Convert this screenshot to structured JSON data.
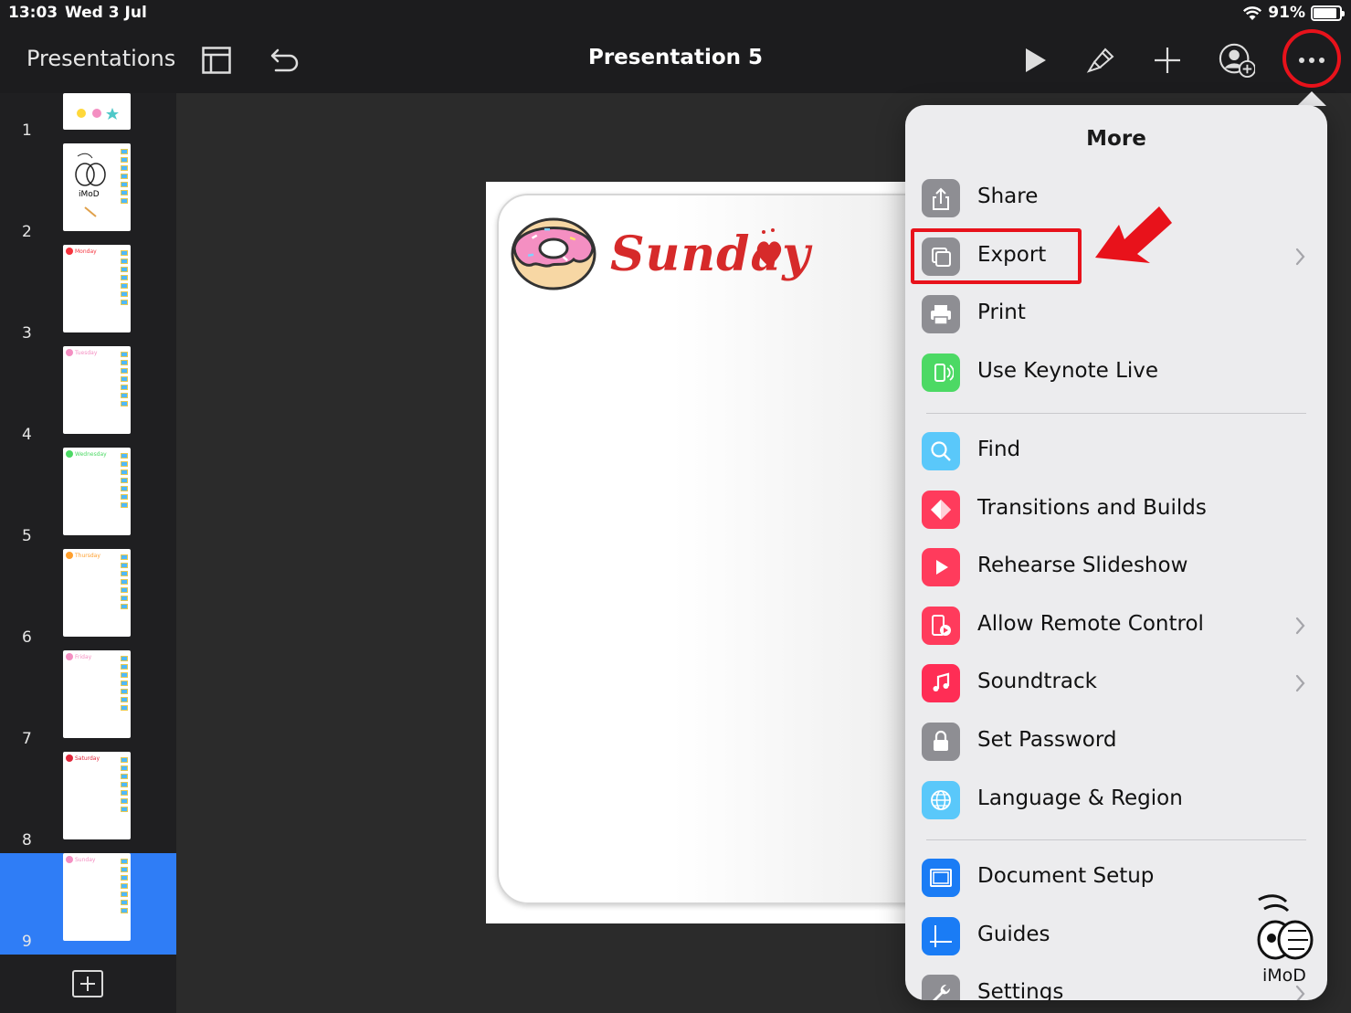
{
  "status_bar": {
    "time": "13:03",
    "date": "Wed 3 Jul",
    "battery_percent": "91%",
    "battery_level": 0.91
  },
  "toolbar": {
    "presentations_label": "Presentations",
    "document_title": "Presentation 5",
    "icons": [
      "slide-navigator-icon",
      "undo-icon",
      "play-icon",
      "format-brush-icon",
      "add-icon",
      "collaborate-icon",
      "more-icon"
    ]
  },
  "slides": [
    {
      "number": "1",
      "day": ""
    },
    {
      "number": "2",
      "day": ""
    },
    {
      "number": "3",
      "day": "Monday"
    },
    {
      "number": "4",
      "day": "Tuesday"
    },
    {
      "number": "5",
      "day": "Wednesday"
    },
    {
      "number": "6",
      "day": "Thursday"
    },
    {
      "number": "7",
      "day": "Friday"
    },
    {
      "number": "8",
      "day": "Saturday"
    },
    {
      "number": "9",
      "day": "Sunday"
    }
  ],
  "selected_slide": "9",
  "slide_canvas": {
    "heading": "Sunday"
  },
  "more_menu": {
    "title": "More",
    "groups": [
      [
        {
          "label": "Share",
          "icon": "share-icon",
          "color": "#8e8e93",
          "chevron": false
        },
        {
          "label": "Export",
          "icon": "export-icon",
          "color": "#8e8e93",
          "chevron": true
        },
        {
          "label": "Print",
          "icon": "printer-icon",
          "color": "#8e8e93",
          "chevron": false
        },
        {
          "label": "Use Keynote Live",
          "icon": "keynote-live-icon",
          "color": "#4cd964",
          "chevron": false
        }
      ],
      [
        {
          "label": "Find",
          "icon": "search-icon",
          "color": "#5ac8fa",
          "chevron": false
        },
        {
          "label": "Transitions and Builds",
          "icon": "transitions-icon",
          "color": "#ff3b5c",
          "chevron": false
        },
        {
          "label": "Rehearse Slideshow",
          "icon": "rehearse-play-icon",
          "color": "#ff3b5c",
          "chevron": false
        },
        {
          "label": "Allow Remote Control",
          "icon": "remote-control-icon",
          "color": "#ff3b5c",
          "chevron": true
        },
        {
          "label": "Soundtrack",
          "icon": "music-note-icon",
          "color": "#ff2d55",
          "chevron": true
        },
        {
          "label": "Set Password",
          "icon": "lock-icon",
          "color": "#8e8e93",
          "chevron": false
        },
        {
          "label": "Language & Region",
          "icon": "globe-icon",
          "color": "#5ac8fa",
          "chevron": false
        }
      ],
      [
        {
          "label": "Document Setup",
          "icon": "document-setup-icon",
          "color": "#1a7cf5",
          "chevron": false
        },
        {
          "label": "Guides",
          "icon": "guides-icon",
          "color": "#1a7cf5",
          "chevron": false
        },
        {
          "label": "Settings",
          "icon": "wrench-icon",
          "color": "#8e8e93",
          "chevron": true
        }
      ]
    ]
  },
  "watermark": {
    "label": "iMoD"
  },
  "colors": {
    "highlight_red": "#e8121b",
    "selection_blue": "#2f7df6",
    "toolbar_bg": "#1c1c1e"
  }
}
